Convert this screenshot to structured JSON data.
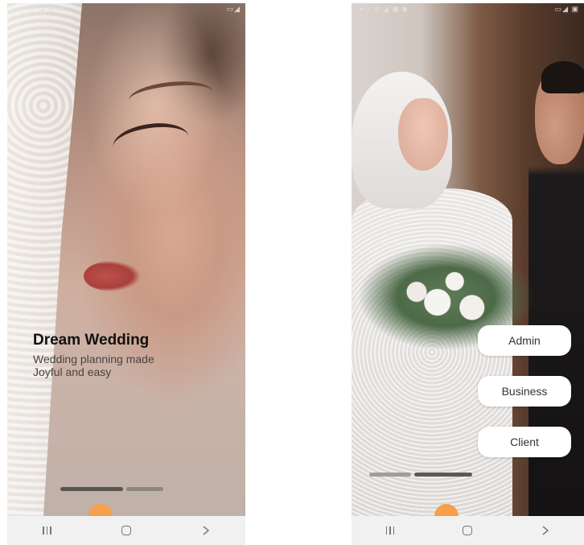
{
  "left_screen": {
    "statusbar": {
      "left_icons": "▫▪▫ᵢₗ ≋ ◢ ▣ ◙",
      "right_icons": "▭◢"
    },
    "title": "Dream Wedding",
    "subtitle": "Wedding planning made Joyful and easy",
    "page_indicator": {
      "pages": 2,
      "active": 1
    }
  },
  "right_screen": {
    "statusbar": {
      "left_icons": "▫▪▫ᵢₗ ≋ ◢ ▣ ◙",
      "right_icons": "▭◢ ▣"
    },
    "buttons": {
      "admin": "Admin",
      "business": "Business",
      "client": "Client"
    },
    "page_indicator": {
      "pages": 2,
      "active": 2
    }
  },
  "navbar": {
    "icons": [
      "recent-apps-icon",
      "home-icon",
      "back-icon"
    ]
  },
  "colors": {
    "accent": "#f5a04b",
    "button_bg": "#ffffff"
  }
}
